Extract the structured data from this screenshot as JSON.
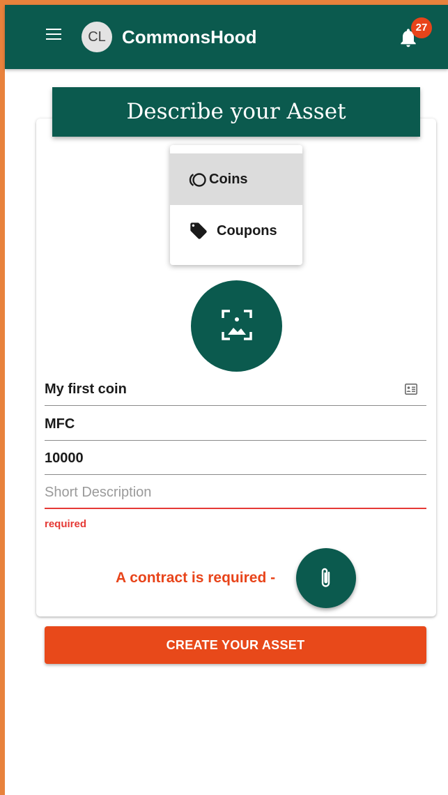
{
  "header": {
    "avatar_initials": "CL",
    "app_title": "CommonsHood",
    "notification_count": "27",
    "menu_icon": "hamburger-menu-icon",
    "bell_icon": "bell-icon"
  },
  "page": {
    "banner_title": "Describe your Asset"
  },
  "asset_type_menu": {
    "items": [
      {
        "label": "Coins",
        "icon": "coins-icon",
        "selected": true
      },
      {
        "label": "Coupons",
        "icon": "tag-icon",
        "selected": false
      }
    ]
  },
  "image_picker": {
    "icon": "image-frame-icon"
  },
  "form": {
    "name_value": "My first coin",
    "name_icon": "contact-card-icon",
    "symbol_value": "MFC",
    "supply_value": "10000",
    "description_value": "",
    "description_placeholder": "Short Description",
    "description_error": "required",
    "contract_message": "A contract is required -",
    "attach_icon": "paperclip-icon",
    "submit_label": "CREATE YOUR ASSET"
  },
  "colors": {
    "primary": "#0b5a4e",
    "accent": "#e8491a",
    "error": "#e53935",
    "frame": "#e8823c"
  }
}
